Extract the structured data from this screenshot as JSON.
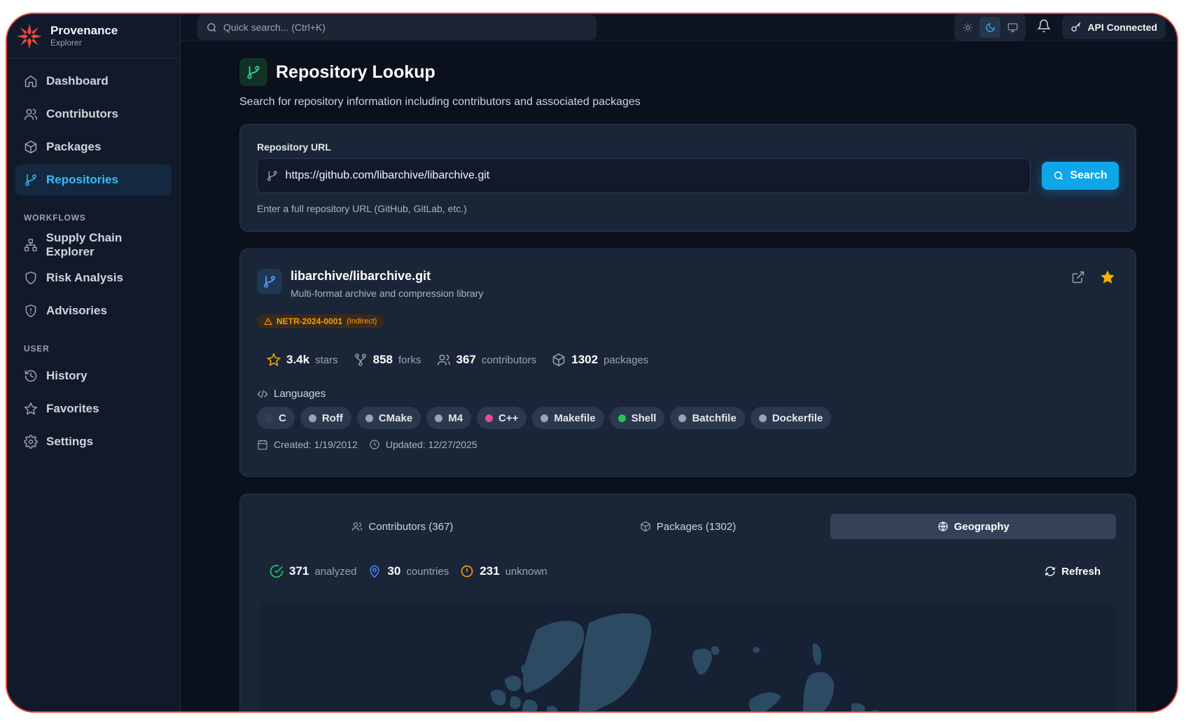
{
  "brand": {
    "name": "Provenance",
    "sub": "Explorer"
  },
  "nav": {
    "main": [
      {
        "label": "Dashboard",
        "icon": "home-icon"
      },
      {
        "label": "Contributors",
        "icon": "users-icon"
      },
      {
        "label": "Packages",
        "icon": "package-icon"
      },
      {
        "label": "Repositories",
        "icon": "git-branch-icon",
        "active": true
      }
    ],
    "workflows_label": "WORKFLOWS",
    "workflows": [
      {
        "label": "Supply Chain Explorer",
        "icon": "network-icon"
      },
      {
        "label": "Risk Analysis",
        "icon": "shield-icon"
      },
      {
        "label": "Advisories",
        "icon": "shield-alert-icon"
      }
    ],
    "user_label": "USER",
    "user": [
      {
        "label": "History",
        "icon": "history-icon"
      },
      {
        "label": "Favorites",
        "icon": "star-icon"
      },
      {
        "label": "Settings",
        "icon": "gear-icon"
      }
    ]
  },
  "topbar": {
    "search_placeholder": "Quick search... (Ctrl+K)",
    "api_status": "API Connected"
  },
  "page": {
    "title": "Repository Lookup",
    "subtitle": "Search for repository information including contributors and associated packages"
  },
  "search": {
    "label": "Repository URL",
    "value": "https://github.com/libarchive/libarchive.git",
    "button": "Search",
    "hint": "Enter a full repository URL (GitHub, GitLab, etc.)"
  },
  "repo": {
    "name": "libarchive/libarchive.git",
    "description": "Multi-format archive and compression library",
    "advisory": {
      "id": "NETR-2024-0001",
      "tag": "(Indirect)"
    },
    "stats": {
      "stars": "3.4k",
      "stars_label": "stars",
      "forks": "858",
      "forks_label": "forks",
      "contributors": "367",
      "contributors_label": "contributors",
      "packages": "1302",
      "packages_label": "packages"
    },
    "languages_label": "Languages",
    "languages": [
      {
        "name": "C",
        "color": "#374151"
      },
      {
        "name": "Roff",
        "color": "#9ca3af"
      },
      {
        "name": "CMake",
        "color": "#9ca3af"
      },
      {
        "name": "M4",
        "color": "#9ca3af"
      },
      {
        "name": "C++",
        "color": "#ec4899"
      },
      {
        "name": "Makefile",
        "color": "#9ca3af"
      },
      {
        "name": "Shell",
        "color": "#22c55e"
      },
      {
        "name": "Batchfile",
        "color": "#9ca3af"
      },
      {
        "name": "Dockerfile",
        "color": "#9ca3af"
      }
    ],
    "created": "Created: 1/19/2012",
    "updated": "Updated: 12/27/2025"
  },
  "tabs": {
    "contributors": "Contributors (367)",
    "packages": "Packages (1302)",
    "geography": "Geography"
  },
  "geo": {
    "analyzed": "371",
    "analyzed_label": "analyzed",
    "countries": "30",
    "countries_label": "countries",
    "unknown": "231",
    "unknown_label": "unknown",
    "refresh": "Refresh"
  },
  "colors": {
    "accent": "#0ea5e9",
    "active_nav": "#38bdf8",
    "warning": "#f59e0b",
    "success": "#22c55e"
  }
}
